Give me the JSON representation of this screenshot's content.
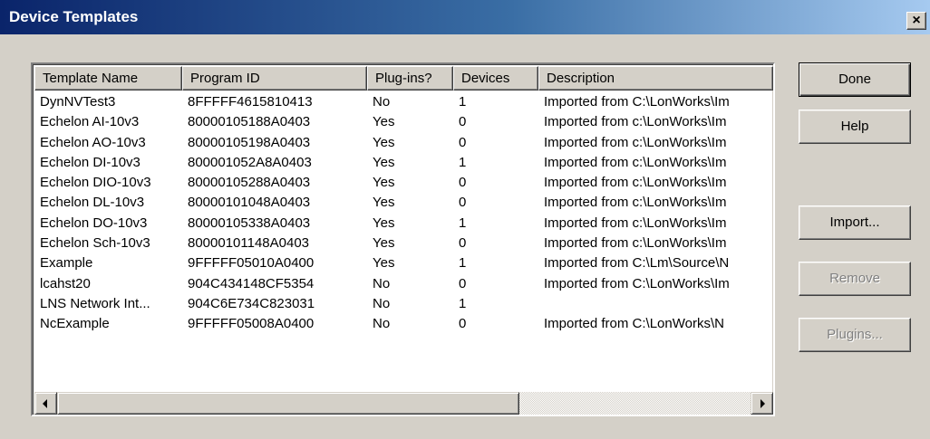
{
  "window": {
    "title": "Device Templates",
    "close_label": "×"
  },
  "columns": [
    "Template Name",
    "Program ID",
    "Plug-ins?",
    "Devices",
    "Description"
  ],
  "rows": [
    {
      "name": "DynNVTest3",
      "program_id": "8FFFFF4615810413",
      "plugins": "No",
      "devices": "1",
      "description": "Imported from C:\\LonWorks\\Im"
    },
    {
      "name": "Echelon AI-10v3",
      "program_id": "80000105188A0403",
      "plugins": "Yes",
      "devices": "0",
      "description": "Imported from c:\\LonWorks\\Im"
    },
    {
      "name": "Echelon AO-10v3",
      "program_id": "80000105198A0403",
      "plugins": "Yes",
      "devices": "0",
      "description": "Imported from c:\\LonWorks\\Im"
    },
    {
      "name": "Echelon DI-10v3",
      "program_id": "800001052A8A0403",
      "plugins": "Yes",
      "devices": "1",
      "description": "Imported from c:\\LonWorks\\Im"
    },
    {
      "name": "Echelon DIO-10v3",
      "program_id": "80000105288A0403",
      "plugins": "Yes",
      "devices": "0",
      "description": "Imported from c:\\LonWorks\\Im"
    },
    {
      "name": "Echelon DL-10v3",
      "program_id": "80000101048A0403",
      "plugins": "Yes",
      "devices": "0",
      "description": "Imported from c:\\LonWorks\\Im"
    },
    {
      "name": "Echelon DO-10v3",
      "program_id": "80000105338A0403",
      "plugins": "Yes",
      "devices": "1",
      "description": "Imported from c:\\LonWorks\\Im"
    },
    {
      "name": "Echelon Sch-10v3",
      "program_id": "80000101148A0403",
      "plugins": "Yes",
      "devices": "0",
      "description": "Imported from c:\\LonWorks\\Im"
    },
    {
      "name": "Example",
      "program_id": "9FFFFF05010A0400",
      "plugins": "Yes",
      "devices": "1",
      "description": "Imported from C:\\Lm\\Source\\N"
    },
    {
      "name": "lcahst20",
      "program_id": "904C434148CF5354",
      "plugins": "No",
      "devices": "0",
      "description": "Imported from C:\\LonWorks\\Im"
    },
    {
      "name": "LNS Network Int...",
      "program_id": "904C6E734C823031",
      "plugins": "No",
      "devices": "1",
      "description": ""
    },
    {
      "name": "NcExample",
      "program_id": "9FFFFF05008A0400",
      "plugins": "No",
      "devices": "0",
      "description": "Imported from C:\\LonWorks\\N"
    }
  ],
  "buttons": {
    "done": {
      "label": "Done",
      "enabled": true
    },
    "help": {
      "label": "Help",
      "enabled": true
    },
    "import": {
      "label": "Import...",
      "enabled": true
    },
    "remove": {
      "label": "Remove",
      "enabled": false
    },
    "plugins": {
      "label": "Plugins...",
      "enabled": false
    }
  },
  "icons": [
    "close-icon",
    "scroll-left-icon",
    "scroll-right-icon"
  ]
}
